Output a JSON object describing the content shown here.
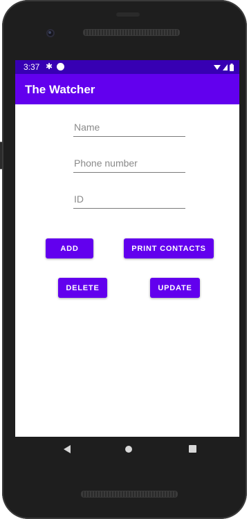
{
  "status_bar": {
    "time": "3:37",
    "settings_icon": "gear-icon",
    "notification_icon": "circle-icon",
    "wifi_icon": "wifi-icon",
    "signal_icon": "signal-icon",
    "battery_icon": "battery-icon",
    "background_color": "#3700b3"
  },
  "app_bar": {
    "title": "The Watcher",
    "background_color": "#6200ee"
  },
  "form": {
    "name_placeholder": "Name",
    "name_value": "",
    "phone_placeholder": "Phone number",
    "phone_value": "",
    "id_placeholder": "ID",
    "id_value": ""
  },
  "buttons": {
    "add": "ADD",
    "print_contacts": "PRINT CONTACTS",
    "delete": "DELETE",
    "update": "UPDATE",
    "color": "#6200ee"
  },
  "nav_bar": {
    "back_icon": "back-triangle-icon",
    "home_icon": "home-circle-icon",
    "recents_icon": "recents-square-icon"
  }
}
